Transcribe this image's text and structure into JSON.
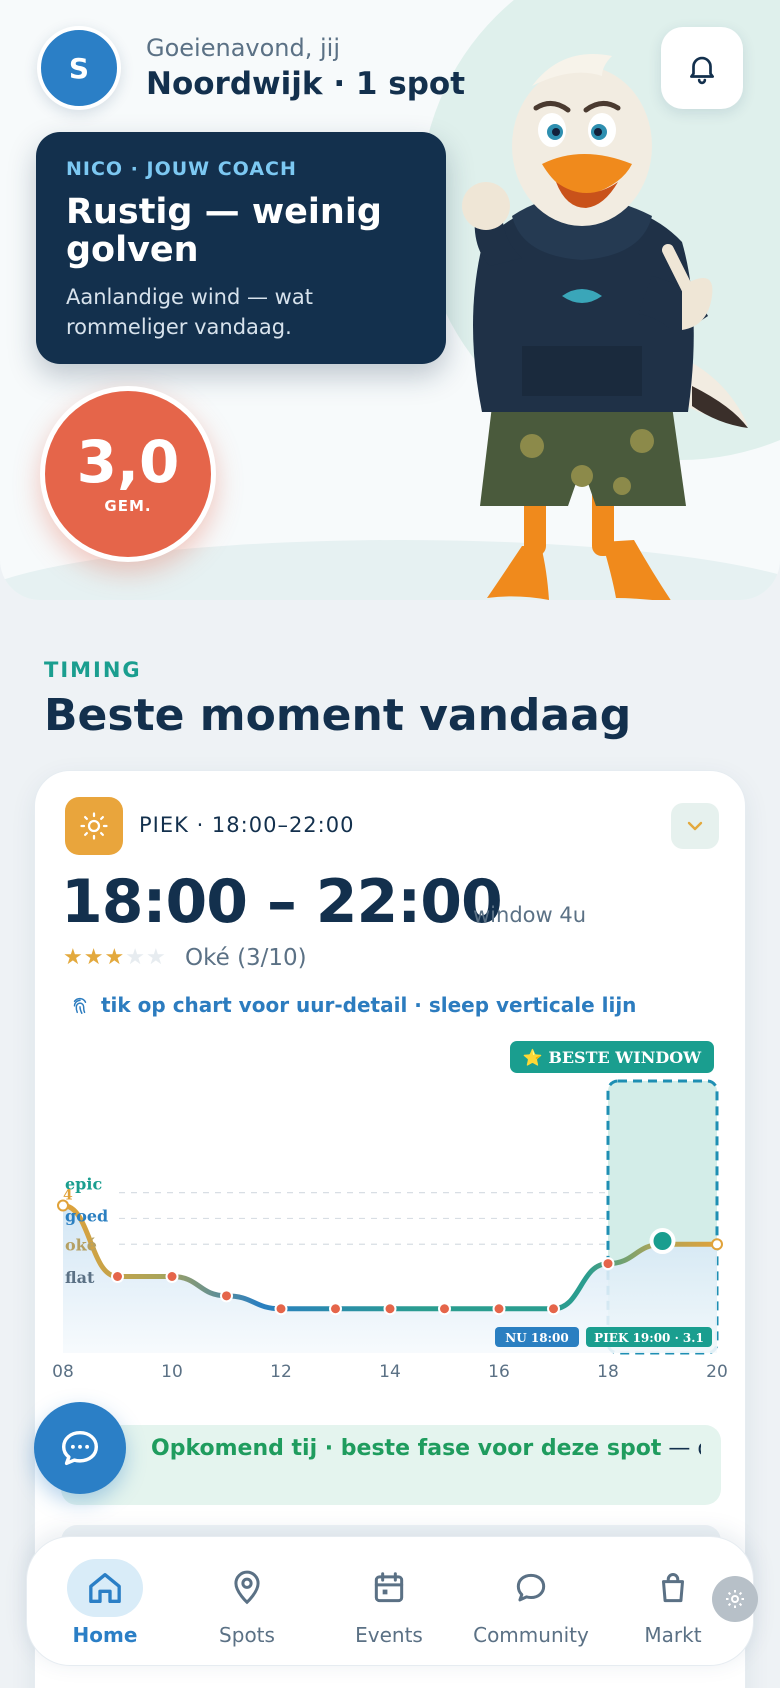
{
  "header": {
    "avatar_initial": "S",
    "greeting": "Goeienavond, jij",
    "location": "Noordwijk · 1 spot",
    "bell_icon": "bell-icon"
  },
  "coach": {
    "label": "NICO · JOUW COACH",
    "title": "Rustig — weinig golven",
    "subtitle": "Aanlandige wind — wat rommeliger vandaag."
  },
  "score": {
    "value": "3,0",
    "label": "GEM."
  },
  "timing": {
    "section_label": "TIMING",
    "title": "Beste moment vandaag",
    "peak_label": "PIEK · 18:00–22:00",
    "time_range": "18:00 – 22:00",
    "window": "window 4u",
    "stars_filled": 3,
    "stars_total": 5,
    "rating_text": "Oké (3/10)",
    "hint": "tik op chart voor uur-detail · sleep verticale lijn"
  },
  "chart_data": {
    "type": "line",
    "x": [
      8,
      9,
      10,
      11,
      12,
      13,
      14,
      15,
      16,
      17,
      18,
      19,
      20
    ],
    "y": [
      4.2,
      2.0,
      2.0,
      1.4,
      1.0,
      1.0,
      1.0,
      1.0,
      1.0,
      1.0,
      2.4,
      3.0,
      3.0
    ],
    "xticks": [
      "08",
      "10",
      "12",
      "14",
      "16",
      "18",
      "20"
    ],
    "ylabels": [
      "epic",
      "goed",
      "oké",
      "flat"
    ],
    "ylim": [
      0,
      8
    ],
    "best_window_label": "⭐ BESTE WINDOW",
    "best_window": [
      18,
      20
    ],
    "now_label": "NU 18:00",
    "peak_marker_label": "PIEK 19:00 · 3.1",
    "peak_x": 19,
    "peak_y": 3.1,
    "start_value_label": "4",
    "grid": true,
    "colors": {
      "good": "#e0a23a",
      "flat": "#2a7fc1",
      "mid": "#2a9d8f",
      "window": "#1a9e8f",
      "dot": "#e5654a"
    }
  },
  "tide": {
    "highlight": "Opkomend tij · beste fase voor deze spot",
    "text": " — opkomend tij brengt water over de zandbanken — schonere brea..."
  },
  "nav": {
    "items": [
      {
        "label": "Home",
        "icon": "home-icon"
      },
      {
        "label": "Spots",
        "icon": "pin-icon"
      },
      {
        "label": "Events",
        "icon": "calendar-icon"
      },
      {
        "label": "Community",
        "icon": "chat-bubble-icon"
      },
      {
        "label": "Markt",
        "icon": "bag-icon"
      }
    ]
  }
}
